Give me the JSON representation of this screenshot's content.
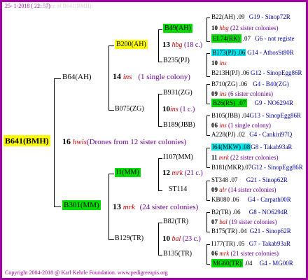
{
  "header": {
    "date": "25- 1-2018 ( 22: 57)"
  },
  "watermark": "Pedigree of B641(BMH):",
  "root": {
    "id": "B641(BMH)",
    "num": "16",
    "code": "hwis",
    "note": "(Drones from 12 sister colonies)"
  },
  "gen1": [
    {
      "id": "B64(AH)",
      "num": "14",
      "code": "ins",
      "note": "(1 single colony)"
    },
    {
      "id": "B301(MM)",
      "num": "13",
      "code": "mrk",
      "note": "(24 sister colonies)"
    }
  ],
  "gen2": [
    {
      "id": "B200(AH)",
      "num": "13",
      "code": "hbg",
      "note": "(18 c.)"
    },
    {
      "id": "B075(ZG)",
      "num": "10",
      "code": "ins",
      "note": "(1 c.)"
    },
    {
      "id": "I1(MM)",
      "num": "12",
      "code": "mrk",
      "note": "(21 c.)"
    },
    {
      "id": "B129(TR)",
      "num": "10",
      "code": "bal",
      "note": "(23 c.)"
    }
  ],
  "gen3": [
    {
      "id": "B49(AH)"
    },
    {
      "id": "B235(PJ)"
    },
    {
      "id": "B931(ZG)",
      "num": "09",
      "code": "ins",
      "note": "(6 sister colonies)"
    },
    {
      "id": "B189(JBB)",
      "num": "06",
      "code": "ins",
      "note": "(1 single colony)"
    },
    {
      "id": "I107(MM)",
      "num": "11",
      "code": "mrk",
      "note": "(22 sister colonies)"
    },
    {
      "id": "ST114",
      "num": "09",
      "code": "alr",
      "note": "(14 sister colonies)"
    },
    {
      "id": "B82(TR)",
      "num": "07",
      "code": "bal",
      "note": "(19 sister colonies)"
    },
    {
      "id": "B135(TR)",
      "num": "06",
      "code": "mrk",
      "note": "(21 sister colonies)"
    }
  ],
  "gen4": [
    {
      "left": "B22(AH)",
      "mid": ".09",
      "right": "G19 - Sinop72R"
    },
    {
      "num": "10",
      "code": "hbg",
      "note": "(22 sister colonies)"
    },
    {
      "left": "EL74(RK)",
      "mid": ".07",
      "right": "G6 - not registe"
    },
    {
      "left": "B173(PJ)",
      "mid": ".06",
      "right": "G14 - AthosSt80R"
    },
    {
      "num": "10",
      "code": "ins"
    },
    {
      "left": "B213H(PJ)",
      "mid": ".06",
      "right": "G12 - SinopEgg86R"
    },
    {
      "left": "B710(ZG)",
      "mid": ".06",
      "right": "G4 - B40(ZG)"
    },
    {
      "left": "B26(RS)",
      "mid": ".07",
      "right": "G9 - NO6294R"
    },
    {
      "left": "B105(JBB)",
      "mid": ".04",
      "right": "G13 - SinopEgg86R"
    },
    {
      "left": "A228(PJ)",
      "mid": ".02",
      "right": "G4 - Cankiri97Q"
    },
    {
      "left": "I64(MKW)",
      "mid": ".08",
      "right": "G8 - Takab93aR"
    },
    {
      "left": "B181(MKR)",
      "mid": ".07",
      "right": "G12 - SinopEgg86R"
    },
    {
      "left": "ST348",
      "mid": ".07",
      "right": "G21 - Sinop62R"
    },
    {
      "left": "KB080",
      "mid": ".06",
      "right": "G4 - Carpath00R"
    },
    {
      "left": "B2(TR)",
      "mid": ".06",
      "right": "G8 - NO6294R"
    },
    {
      "left": "B175(TR)",
      "mid": ".04",
      "right": "G21 - Sinop62R"
    },
    {
      "left": "I177(TR)",
      "mid": ".05",
      "right": "G7 - Takab93aR"
    },
    {
      "left": "MG60(TR)",
      "mid": ".04",
      "right": "G4 - MG00R"
    }
  ],
  "footer": "Copyright 2004-2018 @ Karl Kehrle Foundation.   www.pedigreeapis.org",
  "colors": {
    "border": "#a000a0",
    "root_bg": "#ffff00",
    "green_bg": "#00dd00",
    "cyan_bg": "#00e8ee",
    "code": "#cc0000",
    "gen_link": "#0000a0",
    "gray": "#7a7a7a"
  }
}
